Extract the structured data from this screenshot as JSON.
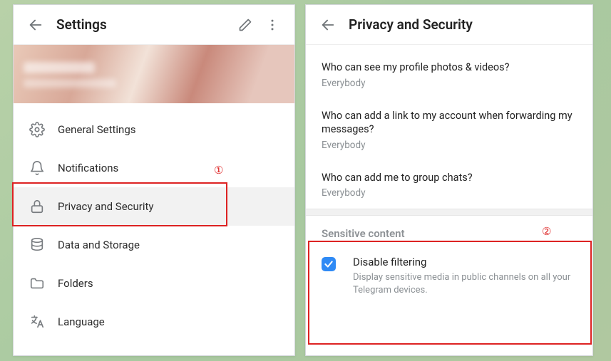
{
  "left": {
    "title": "Settings",
    "items": [
      {
        "label": "General Settings"
      },
      {
        "label": "Notifications"
      },
      {
        "label": "Privacy and Security"
      },
      {
        "label": "Data and Storage"
      },
      {
        "label": "Folders"
      },
      {
        "label": "Language"
      }
    ]
  },
  "right": {
    "title": "Privacy and Security",
    "privacy": [
      {
        "q": "Who can see my profile photos & videos?",
        "a": "Everybody"
      },
      {
        "q": "Who can add a link to my account when forwarding my messages?",
        "a": "Everybody"
      },
      {
        "q": "Who can add me to group chats?",
        "a": "Everybody"
      }
    ],
    "section_title": "Sensitive content",
    "checkbox": {
      "label": "Disable filtering",
      "sub": "Display sensitive media in public channels on all your Telegram devices.",
      "checked": true
    }
  },
  "annotations": {
    "one": "①",
    "two": "②"
  }
}
